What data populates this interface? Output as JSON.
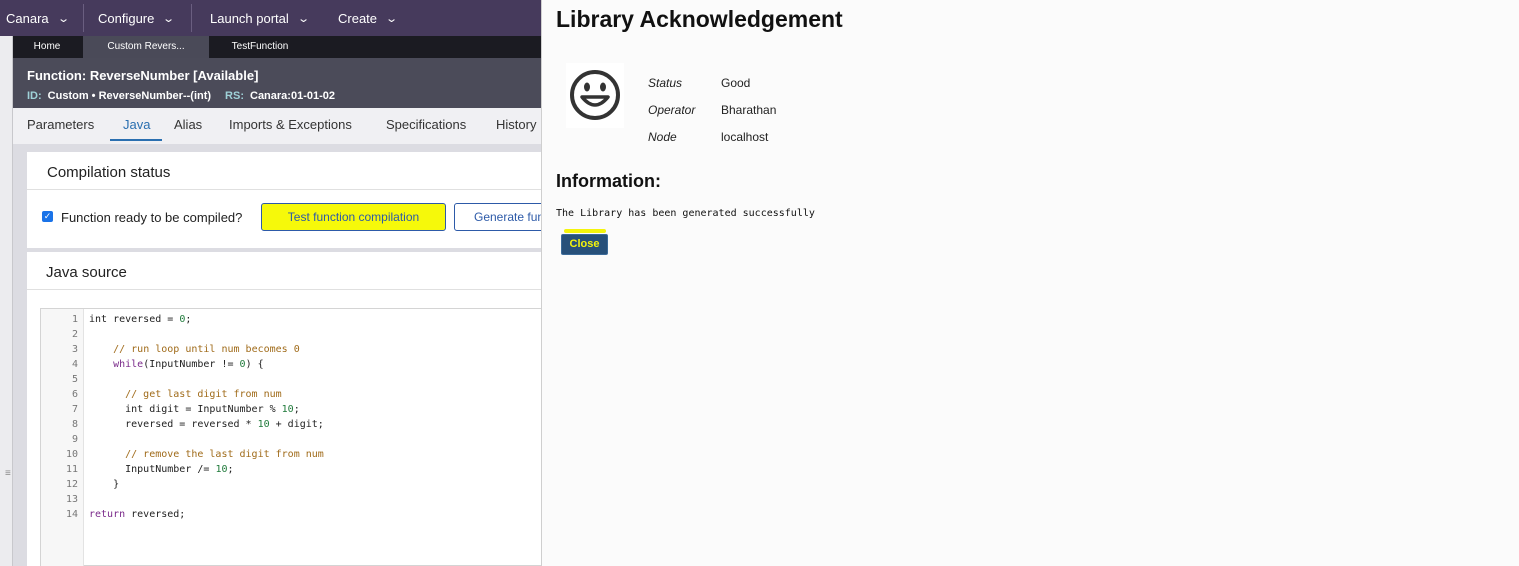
{
  "topbar": {
    "items": [
      {
        "label": "Canara"
      },
      {
        "label": "Configure"
      },
      {
        "label": "Launch portal"
      },
      {
        "label": "Create"
      }
    ]
  },
  "doc_tabs": [
    {
      "label": "Home"
    },
    {
      "label": "Custom Revers..."
    },
    {
      "label": "TestFunction"
    }
  ],
  "rule_header": {
    "title": "Function: ReverseNumber [Available]",
    "id_label": "ID:",
    "id_value": "Custom • ReverseNumber--(int)",
    "rs_label": "RS:",
    "rs_value": "Canara:01-01-02"
  },
  "sub_tabs": [
    {
      "label": "Parameters"
    },
    {
      "label": "Java"
    },
    {
      "label": "Alias"
    },
    {
      "label": "Imports & Exceptions"
    },
    {
      "label": "Specifications"
    },
    {
      "label": "History"
    }
  ],
  "compilation": {
    "title": "Compilation status",
    "checkbox_label": "Function ready to be compiled?",
    "checked": true,
    "test_button": "Test function compilation",
    "generate_button": "Generate function"
  },
  "java_source": {
    "title": "Java source",
    "line_numbers": [
      "1",
      "2",
      "3",
      "4",
      "5",
      "6",
      "7",
      "8",
      "9",
      "10",
      "11",
      "12",
      "13",
      "14"
    ]
  },
  "dialog": {
    "title": "Library Acknowledgement",
    "fields": [
      {
        "label": "Status",
        "value": "Good"
      },
      {
        "label": "Operator",
        "value": "Bharathan"
      },
      {
        "label": "Node",
        "value": "localhost"
      }
    ],
    "info_title": "Information:",
    "info_text": "The Library has been generated successfully",
    "close_button": "Close"
  },
  "colors": {
    "topbar": "#463a5c",
    "highlight": "#f6f90a",
    "accent": "#2d5aa8",
    "close_button": "#27507a"
  }
}
